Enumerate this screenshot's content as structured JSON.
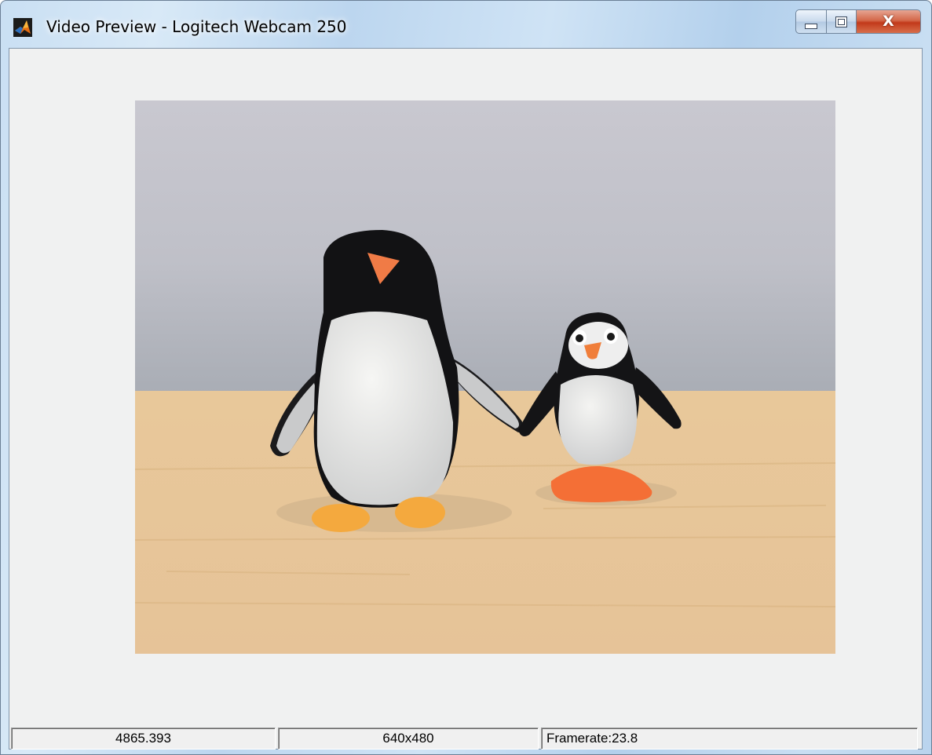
{
  "window": {
    "title": "Video Preview - Logitech Webcam 250",
    "app_icon": "matlab-icon",
    "buttons": {
      "minimize": "minimize-icon",
      "maximize": "maximize-icon",
      "close": "close-icon"
    }
  },
  "preview": {
    "content": "penguin-figurines-live-video"
  },
  "status": {
    "timestamp": "4865.393",
    "resolution": "640x480",
    "framerate": "Framerate:23.8"
  },
  "colors": {
    "client_bg": "#f0f1f1",
    "wall": "#c7c7cf",
    "table": "#e6c496",
    "close_button": "#c8452a"
  }
}
